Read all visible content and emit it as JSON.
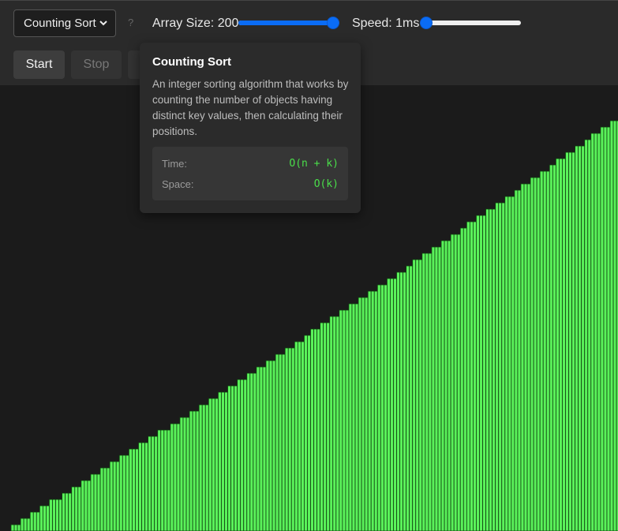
{
  "controls": {
    "algorithm_selected": "Counting Sort",
    "help_glyph": "?",
    "array_size_label": "Array Size: 200",
    "array_size_value": 200,
    "speed_label": "Speed: 1ms",
    "speed_value_ms": 1,
    "start_label": "Start",
    "stop_label": "Stop"
  },
  "tooltip": {
    "title": "Counting Sort",
    "description": "An integer sorting algorithm that works by counting the number of objects having distinct key values, then calculating their positions.",
    "time_label": "Time:",
    "time_value": "O(n + k)",
    "space_label": "Space:",
    "space_value": "O(k)"
  },
  "chart_data": {
    "type": "bar",
    "count": 200,
    "values_description": "sorted ascending array of 200 bars",
    "min_value": 6,
    "max_value": 550,
    "bar_color": "#5af25a",
    "bar_border_color": "#0f3d0f",
    "background": "#1b1b1b"
  },
  "colors": {
    "accent": "#0a6cf5",
    "bar": "#5af25a",
    "complexity_text": "#4ade4a"
  }
}
